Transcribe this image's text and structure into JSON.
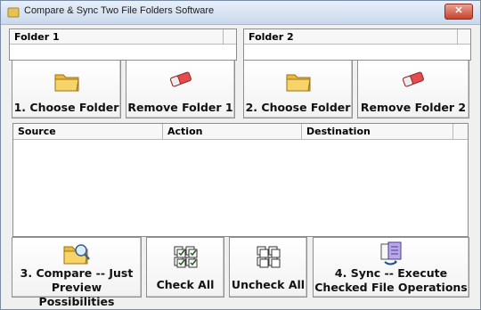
{
  "window": {
    "title": "Compare & Sync Two File Folders Software",
    "close_label": "✕"
  },
  "folder1": {
    "label": "Folder 1"
  },
  "folder2": {
    "label": "Folder 2"
  },
  "buttons": {
    "choose1": "1. Choose Folder",
    "remove1": "Remove Folder 1",
    "choose2": "2. Choose Folder",
    "remove2": "Remove Folder 2",
    "compare_line1": "3. Compare -- Just",
    "compare_line2": "Preview Possibilities",
    "check_all": "Check All",
    "uncheck_all": "Uncheck All",
    "sync_line1": "4. Sync -- Execute",
    "sync_line2": "Checked File Operations"
  },
  "grid": {
    "columns": [
      "Source",
      "Action",
      "Destination"
    ]
  },
  "icons": {
    "app": "app-icon",
    "folder": "folder-icon",
    "eraser": "eraser-icon",
    "compare": "compare-icon",
    "check": "check-all-icon",
    "uncheck": "uncheck-all-icon",
    "sync": "sync-icon"
  }
}
